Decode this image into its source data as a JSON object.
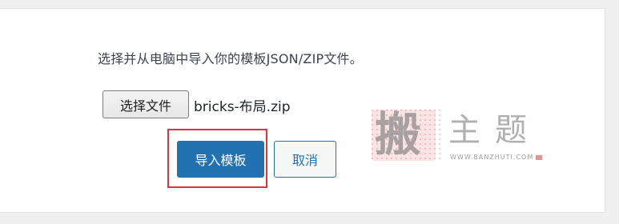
{
  "import_panel": {
    "instruction": "选择并从电脑中导入你的模板JSON/ZIP文件。",
    "file_button_label": "选择文件",
    "file_name": "bricks-布局.zip",
    "import_button_label": "导入模板",
    "cancel_button_label": "取消"
  },
  "watermark": {
    "seal_char": "搬",
    "text": "主题",
    "url": "WWW.BANZHUTI.COM"
  },
  "colors": {
    "primary": "#2271b1",
    "highlight": "#e3343e",
    "background": "#f0f0f1",
    "panel": "#ffffff"
  }
}
